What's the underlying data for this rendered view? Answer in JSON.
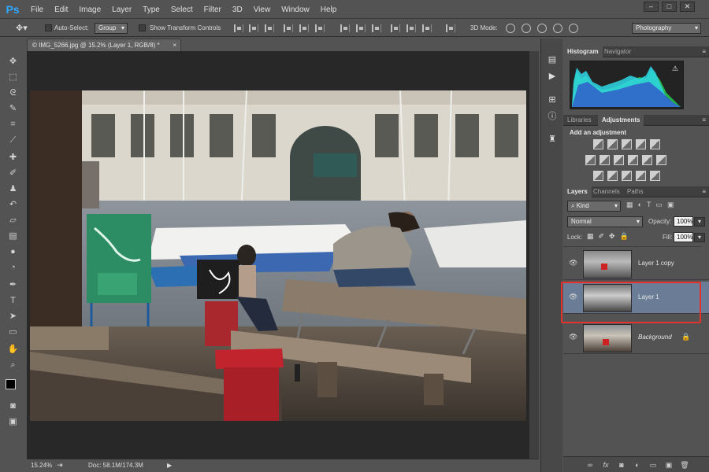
{
  "app": {
    "logo": "Ps",
    "menus": [
      "File",
      "Edit",
      "Image",
      "Layer",
      "Type",
      "Select",
      "Filter",
      "3D",
      "View",
      "Window",
      "Help"
    ]
  },
  "window_controls": [
    "–",
    "□",
    "✕"
  ],
  "options_bar": {
    "auto_select_label": "Auto-Select:",
    "auto_select_value": "Group",
    "transform_label": "Show Transform Controls",
    "mode_3d_label": "3D Mode:",
    "workspace": "Photography"
  },
  "document": {
    "tab_title": "© IMG_5266.jpg @ 15.2% (Layer 1, RGB/8) *",
    "zoom": "15.24%",
    "doc_info": "Doc: 58.1M/174.3M"
  },
  "panels": {
    "top_tabs": [
      "Histogram",
      "Navigator"
    ],
    "mid_tabs": [
      "Libraries",
      "Adjustments"
    ],
    "adjustments_title": "Add an adjustment",
    "layer_tabs": [
      "Layers",
      "Channels",
      "Paths"
    ],
    "filter_kind": "Kind",
    "blend_mode": "Normal",
    "opacity_label": "Opacity:",
    "opacity_value": "100%",
    "lock_label": "Lock:",
    "fill_label": "Fill:",
    "fill_value": "100%",
    "layers": [
      {
        "name": "Layer 1 copy",
        "selected": false,
        "locked": false
      },
      {
        "name": "Layer 1",
        "selected": true,
        "locked": false
      },
      {
        "name": "Background",
        "selected": false,
        "locked": true
      }
    ]
  },
  "colors": {
    "accent_selection": "#e5322d",
    "layer_selected": "#6b7d96",
    "logo": "#31a8ff"
  },
  "icons": {
    "tools": [
      "move-tool-icon",
      "marquee-icon",
      "lasso-icon",
      "quick-select-icon",
      "crop-icon",
      "eyedropper-icon",
      "healing-icon",
      "brush-icon",
      "stamp-icon",
      "history-brush-icon",
      "eraser-icon",
      "gradient-icon",
      "blur-icon",
      "dodge-icon",
      "pen-icon",
      "type-icon",
      "path-select-icon",
      "rectangle-icon",
      "hand-icon",
      "zoom-icon"
    ]
  }
}
